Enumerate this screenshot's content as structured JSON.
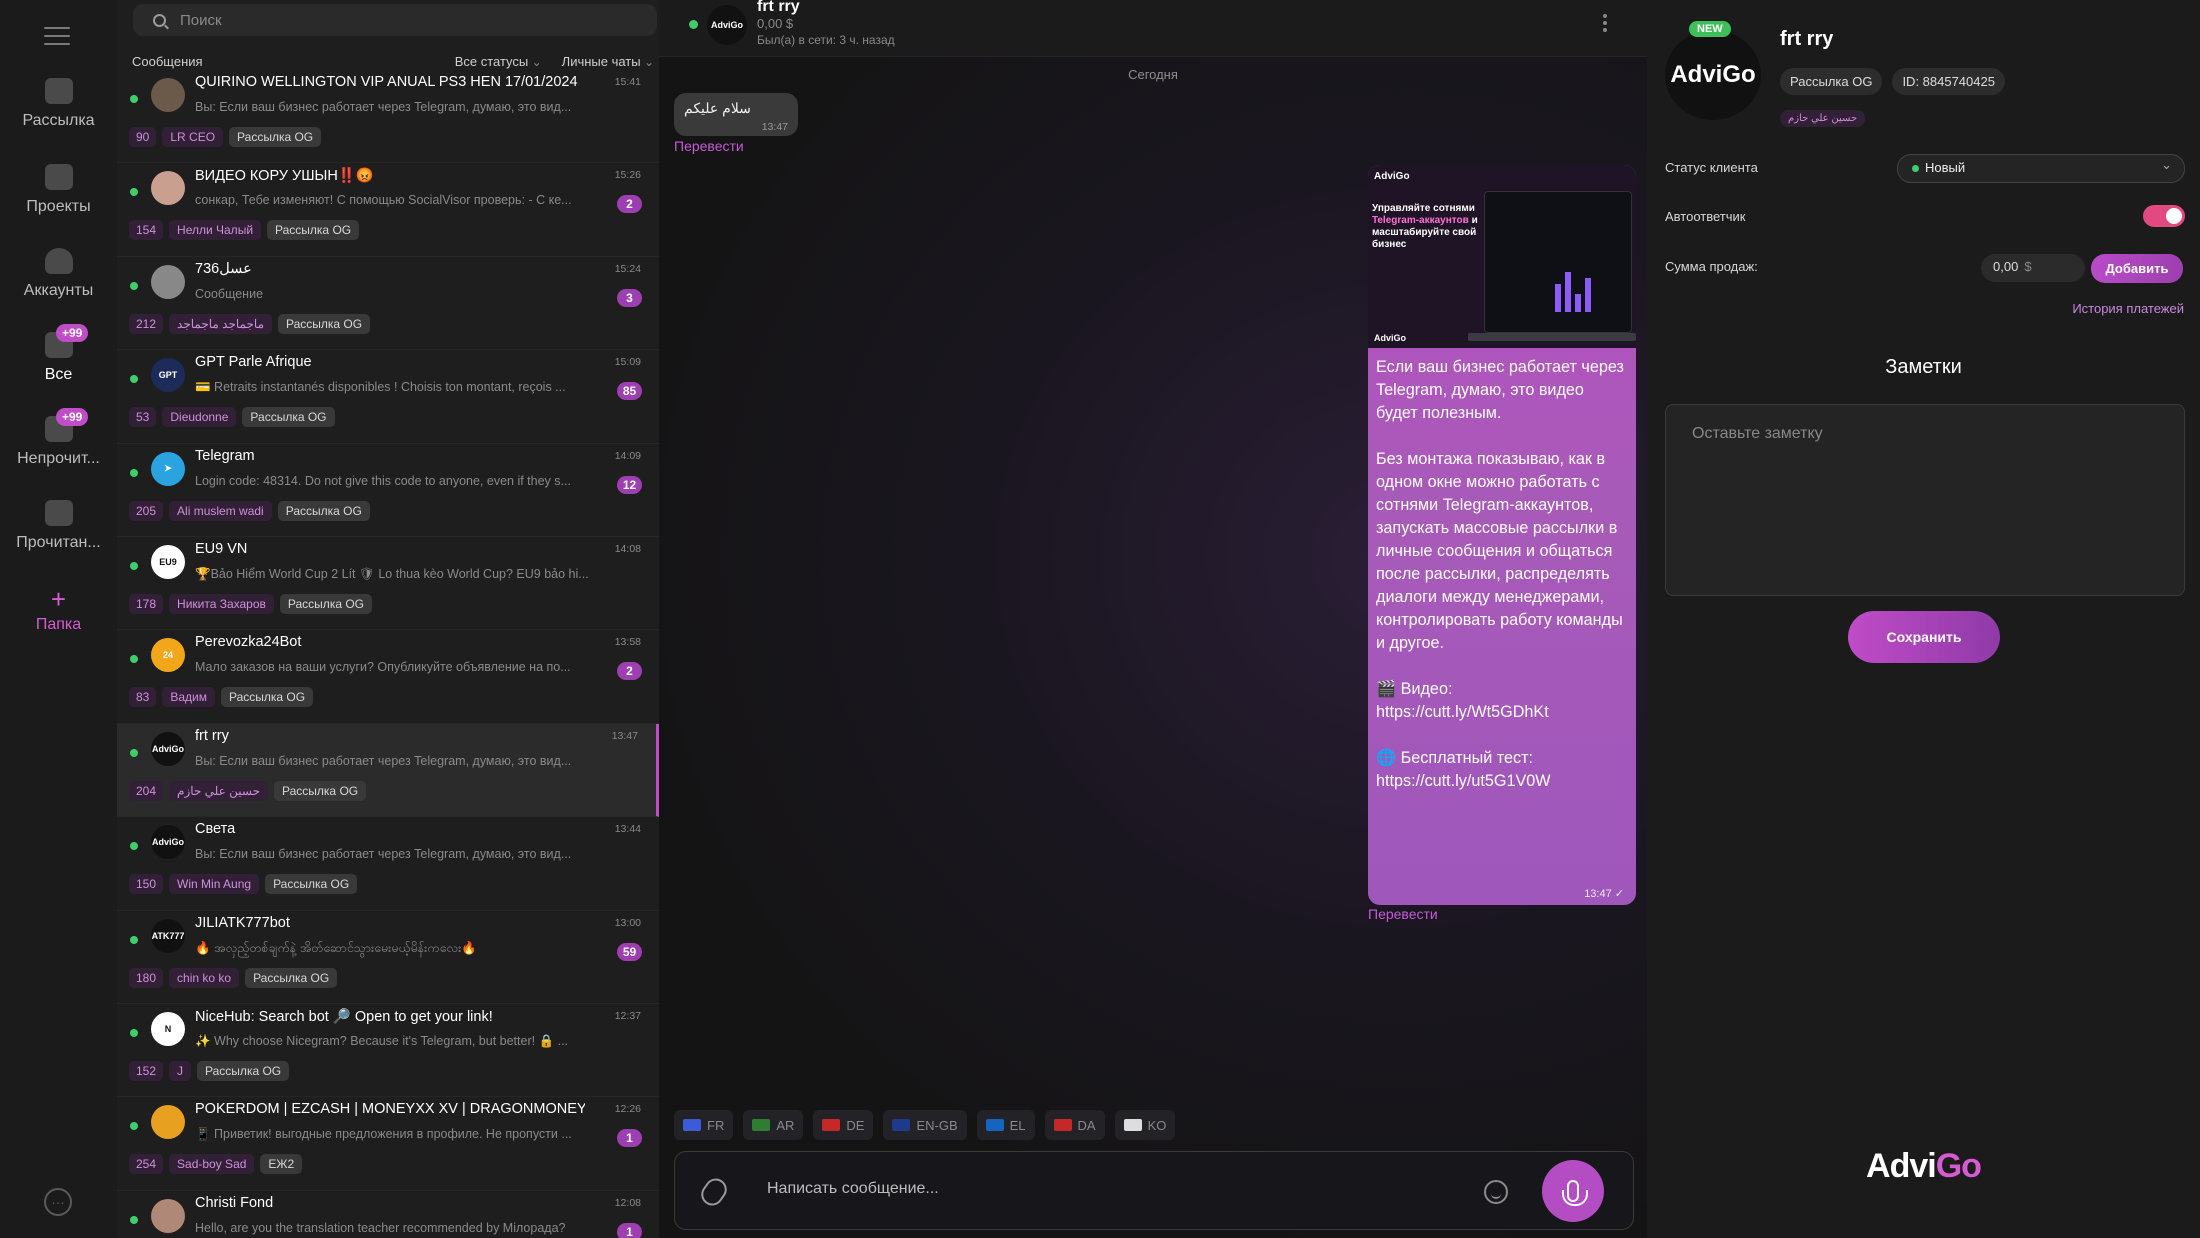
{
  "nav": {
    "items": [
      {
        "label": "Рассылка",
        "icon": "megaphone-icon"
      },
      {
        "label": "Проекты",
        "icon": "folder-icon"
      },
      {
        "label": "Аккаунты",
        "icon": "users-icon"
      },
      {
        "label": "Все",
        "icon": "chats-icon",
        "badge": "+99"
      },
      {
        "label": "Непрочит...",
        "icon": "unread-icon",
        "badge": "+99"
      },
      {
        "label": "Прочитан...",
        "icon": "read-icon"
      }
    ],
    "folder": {
      "plus": "+",
      "label": "Папка"
    },
    "more": "…"
  },
  "chatlist": {
    "search_placeholder": "Поиск",
    "section": "Сообщения",
    "filter_status": "Все статусы",
    "filter_type": "Личные чаты",
    "chats": [
      {
        "name": "QUIRINO WELLINGTON VIP ANUAL PS3 HEN 17/01/2024",
        "time": "15:41",
        "preview": "Вы: Если ваш бизнес работает через Telegram, думаю, это вид...",
        "unread": "",
        "tags": [
          "90",
          "LR CEO",
          "Рассылка OG"
        ],
        "avatar_color": "#6b5a4a",
        "avatar_text": ""
      },
      {
        "name": "ВИДЕО КОРУ УШЫН‼️😡",
        "time": "15:26",
        "preview": "сонкар, Тебе изменяют! С помощью SocialVisor проверь: - С ке...",
        "unread": "2",
        "tags": [
          "154",
          "Нелли Чалый",
          "Рассылка OG"
        ],
        "avatar_color": "#c9a090",
        "avatar_text": ""
      },
      {
        "name": "736عسل",
        "time": "15:24",
        "preview": "Сообщение",
        "unread": "3",
        "tags": [
          "212",
          "ماجماجد ماجماجد",
          "Рассылка OG"
        ],
        "avatar_color": "#888",
        "avatar_text": ""
      },
      {
        "name": "GPT Parle Afrique",
        "time": "15:09",
        "preview": "💳 Retraits instantanés disponibles ! Choisis ton montant, reçois ...",
        "unread": "85",
        "tags": [
          "53",
          "Dieudonne",
          "Рассылка OG"
        ],
        "avatar_color": "#1d2b5a",
        "avatar_text": "GPT"
      },
      {
        "name": "Telegram",
        "time": "14:09",
        "preview": "Login code: 48314. Do not give this code to anyone, even if they s...",
        "unread": "12",
        "tags": [
          "205",
          "Ali muslem wadi",
          "Рассылка OG"
        ],
        "avatar_color": "#2aa3e0",
        "avatar_text": "➤"
      },
      {
        "name": "EU9 VN",
        "time": "14:08",
        "preview": "🏆Bảo Hiểm World Cup 2 Lít 🛡 Lo thua kèo World Cup? EU9 bảo hi...",
        "unread": "",
        "tags": [
          "178",
          "Никита Захаров",
          "Рассылка OG"
        ],
        "avatar_color": "#ffffff",
        "avatar_text": "EU9"
      },
      {
        "name": "Perevozka24Bot",
        "time": "13:58",
        "preview": "Мало заказов на ваши услуги? Опубликуйте объявление на по...",
        "unread": "2",
        "tags": [
          "83",
          "Вадим",
          "Рассылка OG"
        ],
        "avatar_color": "#f2a71b",
        "avatar_text": "24"
      },
      {
        "name": "frt rry",
        "time": "13:47",
        "preview": "Вы: Если ваш бизнес работает через Telegram, думаю, это вид...",
        "unread": "",
        "tags": [
          "204",
          "حسين علي حازم",
          "Рассылка OG"
        ],
        "avatar_color": "#111111",
        "avatar_text": "AdviGo",
        "active": true
      },
      {
        "name": "Света",
        "time": "13:44",
        "preview": "Вы: Если ваш бизнес работает через Telegram, думаю, это вид...",
        "unread": "",
        "tags": [
          "150",
          "Win Min Aung",
          "Рассылка OG"
        ],
        "avatar_color": "#111111",
        "avatar_text": "AdviGo"
      },
      {
        "name": "JILIATK777bot",
        "time": "13:00",
        "preview": "🔥 အလှည့်တစ်ချက်နဲ့ အိတ်ဆောင်သွားမေးမယ့်မိန်းကလေး🔥",
        "unread": "59",
        "tags": [
          "180",
          "chin ko ko",
          "Рассылка OG"
        ],
        "avatar_color": "#111111",
        "avatar_text": "ATK777"
      },
      {
        "name": "NiceHub: Search bot 🔎 Open to get your link!",
        "time": "12:37",
        "preview": "✨ Why choose Nicegram? Because it's Telegram, but better! 🔒 ...",
        "unread": "",
        "tags": [
          "152",
          "J",
          "Рассылка OG"
        ],
        "avatar_color": "#ffffff",
        "avatar_text": "N"
      },
      {
        "name": "POKERDOM | EZCASH | MONEYXX XV | DRAGONMONEYXV",
        "time": "12:26",
        "preview": "📱 Приветик! выгодные предложения в профиле. Не пропусти ...",
        "unread": "1",
        "tags": [
          "254",
          "Sad-boy Sad",
          "ЕЖ2"
        ],
        "avatar_color": "#e8a020",
        "avatar_text": ""
      },
      {
        "name": "Christi Fond",
        "time": "12:08",
        "preview": "Hello, are you the translation teacher recommended by Miлорада?",
        "unread": "1",
        "tags": [],
        "avatar_color": "#b08878",
        "avatar_text": ""
      }
    ]
  },
  "conversation": {
    "name": "frt rry",
    "balance": "0,00 $",
    "last_seen": "Был(а) в сети: 3 ч. назад",
    "avatar_text": "AdviGo",
    "date_divider": "Сегодня",
    "incoming": {
      "text": "سلام علیکم",
      "time": "13:47"
    },
    "translate_label": "Перевести",
    "outgoing": {
      "promo_logo": "AdviGo",
      "promo_heading_1": "Управляйте сотнями ",
      "promo_heading_accent": "Telegram-аккаунтов",
      "promo_heading_2": " и масштабируйте свой бизнес",
      "text": "Если ваш бизнес работает через Telegram, думаю, это видео будет полезным.\n\nБез монтажа показываю, как в одном окне можно работать с сотнями Telegram-аккаунтов, запускать массовые рассылки в личные сообщения и общаться после рассылки, распределять диалоги между менеджерами, контролировать работу команды и другое.\n\n🎬 Видео:\nhttps://cutt.ly/Wt5GDhKt\n\n🌐 Бесплатный тест:\nhttps://cutt.ly/ut5G1V0W",
      "time": "13:47 ✓"
    },
    "languages": [
      {
        "code": "FR",
        "flag": "#3b5bd9"
      },
      {
        "code": "AR",
        "flag": "#2e7d32"
      },
      {
        "code": "DE",
        "flag": "#c62828"
      },
      {
        "code": "EN-GB",
        "flag": "#1e3a8a"
      },
      {
        "code": "EL",
        "flag": "#1565c0"
      },
      {
        "code": "DA",
        "flag": "#c62828"
      },
      {
        "code": "KO",
        "flag": "#dddddd"
      }
    ],
    "composer_placeholder": "Написать сообщение..."
  },
  "profile": {
    "new_badge": "NEW",
    "avatar_text": "AdviGo",
    "name": "frt rry",
    "tag_mailing": "Рассылка OG",
    "tag_id": "ID: 8845740425",
    "tag_manager": "حسين علي حازم",
    "status_label": "Статус клиента",
    "status_value": "Новый",
    "autoresponder_label": "Автоответчик",
    "autoresponder_on": true,
    "sales_label": "Сумма продаж:",
    "sales_value": "0,00",
    "sales_currency": "$",
    "add_button": "Добавить",
    "history_link": "История платежей",
    "notes_title": "Заметки",
    "notes_placeholder": "Оставьте заметку",
    "save_button": "Сохранить",
    "logo_a": "Advi",
    "logo_b": "Go"
  },
  "colors": {
    "accent": "#c04cc8",
    "online": "#3fcf6a",
    "toggle_on": "#e04a80"
  }
}
